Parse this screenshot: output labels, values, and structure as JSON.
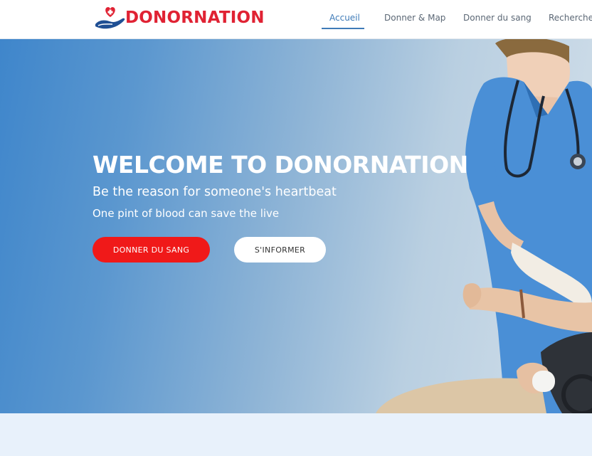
{
  "brand": {
    "name": "DONORNATION",
    "colors": {
      "red": "#e02233",
      "blue": "#3f7bb8"
    }
  },
  "nav": {
    "items": [
      {
        "label": "Accueil",
        "active": true
      },
      {
        "label": "Donner & Map",
        "active": false
      },
      {
        "label": "Donner du sang",
        "active": false
      },
      {
        "label": "Rechercher",
        "active": false
      }
    ]
  },
  "hero": {
    "title": "WELCOME TO DONORNATION",
    "subtitle": "Be the reason for someone's heartbeat",
    "tagline": "One pint of blood can save the live",
    "buttons": {
      "primary": "DONNER DU SANG",
      "secondary": "S'INFORMER"
    }
  },
  "icons": {
    "logo": "heart-hand-icon"
  }
}
